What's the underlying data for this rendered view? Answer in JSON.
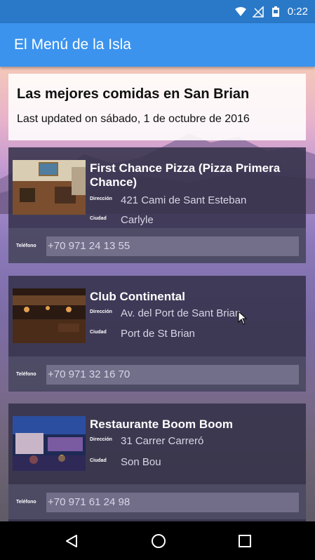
{
  "status_bar": {
    "time": "0:22",
    "icons": [
      "wifi-icon",
      "no-signal-icon",
      "battery-icon"
    ]
  },
  "app_bar": {
    "title": "El Menú de la Isla"
  },
  "header": {
    "title": "Las mejores comidas en San Brian",
    "subtitle": "Last updated on sábado, 1 de octubre de 2016"
  },
  "labels": {
    "address": "Dirección",
    "city": "Ciudad",
    "phone": "Teléfono"
  },
  "restaurants": [
    {
      "name": "First Chance Pizza (Pizza Primera Chance)",
      "address": "421 Cami de Sant Esteban",
      "city": "Carlyle",
      "phone": "+70 971 24 13 55"
    },
    {
      "name": "Club Continental",
      "address": "Av. del Port de Sant Brian",
      "city": "Port de St Brian",
      "phone": "+70 971 32 16 70"
    },
    {
      "name": "Restaurante Boom Boom",
      "address": "31 Carrer Carreró",
      "city": "Son Bou",
      "phone": "+70 971 61 24 98"
    }
  ],
  "nav": [
    "back-icon",
    "home-icon",
    "recents-icon"
  ],
  "colors": {
    "app_bar": "#3b93ee",
    "status_bar": "#2a79c8",
    "card": "#323048"
  }
}
